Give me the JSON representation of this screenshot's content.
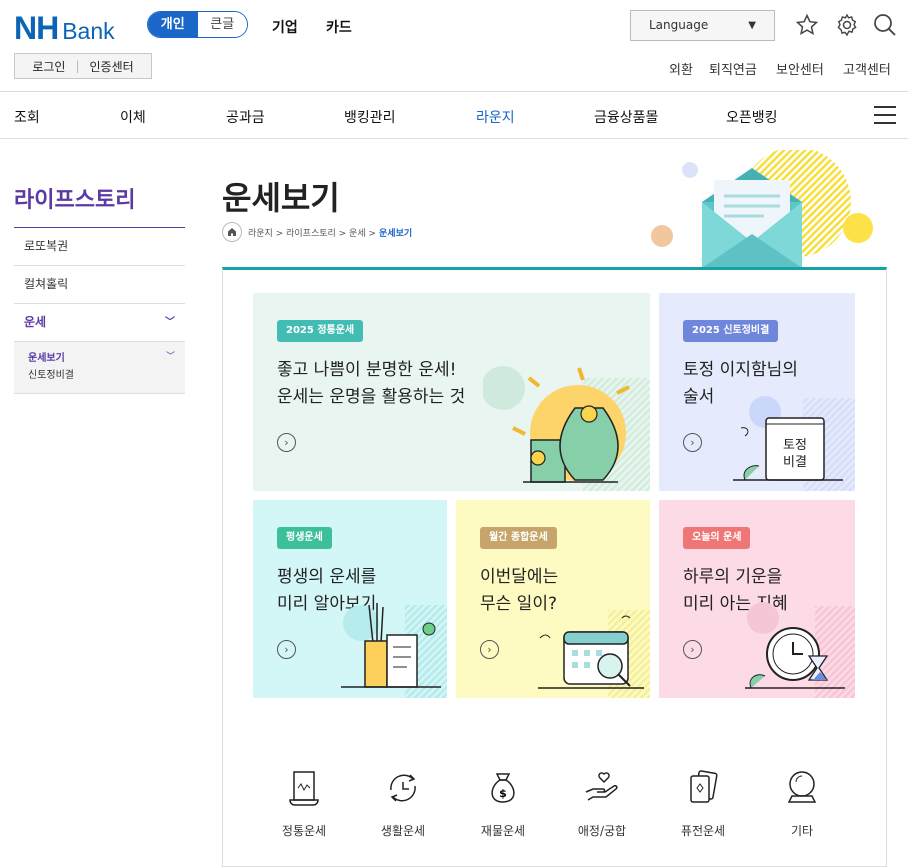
{
  "logo": {
    "nh": "NH",
    "bank": "Bank"
  },
  "segment": {
    "personal": "개인",
    "large_text": "큰글"
  },
  "topnav": {
    "corporate": "기업",
    "card": "카드"
  },
  "language": {
    "label": "Language"
  },
  "login": {
    "login": "로그인",
    "cert": "인증센터"
  },
  "util": {
    "fx": "외환",
    "pension": "퇴직연금",
    "security": "보안센터",
    "customer": "고객센터"
  },
  "gnb": [
    "조회",
    "이체",
    "공과금",
    "뱅킹관리",
    "라운지",
    "금융상품몰",
    "오픈뱅킹"
  ],
  "sidebar": {
    "title": "라이프스토리",
    "items": [
      "로또복권",
      "컬쳐홀릭",
      "운세"
    ],
    "sub": [
      "운세보기",
      "신토정비결"
    ]
  },
  "page": {
    "title": "운세보기"
  },
  "breadcrumb": {
    "path": "라운지 > 라이프스토리 > 운세 > ",
    "current": "운세보기"
  },
  "cards": {
    "c1": {
      "tag": "2025 정통운세",
      "text": "좋고 나쁨이 분명한 운세!\n운세는 운명을 활용하는 것"
    },
    "c2": {
      "tag": "2025 신토정비결",
      "text": "토정 이지함님의\n술서",
      "book": "토정\n비결"
    },
    "c3": {
      "tag": "평생운세",
      "text": "평생의 운세를\n미리 알아보기"
    },
    "c4": {
      "tag": "월간 종합운세",
      "text": "이번달에는\n무슨 일이?"
    },
    "c5": {
      "tag": "오늘의 운세",
      "text": "하루의 기운을\n미리 아는 지혜"
    }
  },
  "categories": [
    "정통운세",
    "생활운세",
    "재물운세",
    "애정/궁합",
    "퓨전운세",
    "기타"
  ],
  "colors": {
    "brand": "#0b64b5",
    "accent": "#5b3aa5",
    "teal": "#17a2a8"
  }
}
